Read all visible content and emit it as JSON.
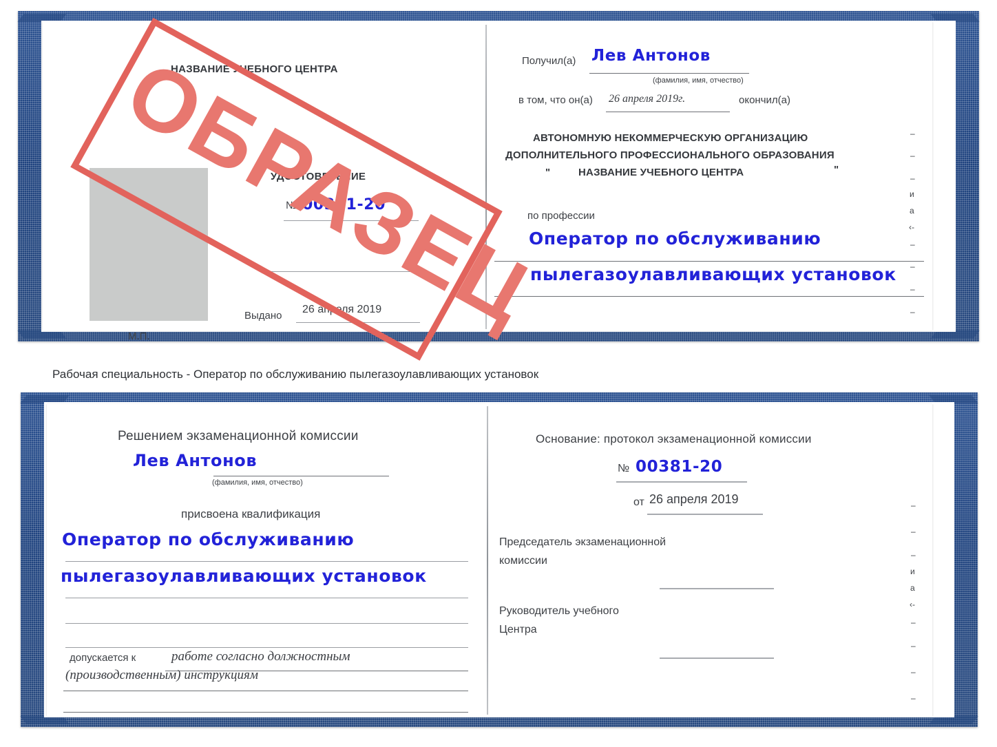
{
  "document": {
    "type": "udostoverenie-certificate-sample",
    "stamp_label": "ОБРАЗЕЦ",
    "caption": "Рабочая специальность - Оператор по обслуживанию пылегазоулавливающих установок"
  },
  "colors": {
    "cover_blue": "#24477f",
    "ink_blue": "#2222d8",
    "stamp_red": "#e2635c",
    "text_gray": "#3d4045",
    "photo_gray": "#c9cbca"
  },
  "cert_top": {
    "left_page": {
      "center_name": "НАЗВАНИЕ УЧЕБНОГО ЦЕНТРА",
      "title": "УДОСТОВЕРЕНИЕ",
      "number_prefix": "№",
      "number_value": "00381-20",
      "issued_label": "Выдано",
      "issued_value": "26 апреля 2019",
      "seal_label": "М.П.",
      "photo_placeholder": "photo-area"
    },
    "right_page": {
      "received_label": "Получил(а)",
      "received_value": "Лев Антонов",
      "fio_hint": "(фамилия, имя, отчество)",
      "in_that_label": "в том, что он(а)",
      "in_that_value": "26 апреля 2019г.",
      "finished_label": "окончил(а)",
      "org_line1": "АВТОНОМНУЮ НЕКОММЕРЧЕСКУЮ ОРГАНИЗАЦИЮ",
      "org_line2": "ДОПОЛНИТЕЛЬНОГО ПРОФЕССИОНАЛЬНОГО ОБРАЗОВАНИЯ",
      "org_quote_open": "\"",
      "org_line3": "НАЗВАНИЕ УЧЕБНОГО ЦЕНТРА",
      "org_quote_close": "\"",
      "profession_label": "по профессии",
      "profession_line1": "Оператор по обслуживанию",
      "profession_line2": "пылегазоулавливающих установок"
    }
  },
  "cert_bottom": {
    "left_page": {
      "heading": "Решением экзаменационной комиссии",
      "name_value": "Лев Антонов",
      "fio_hint": "(фамилия, имя, отчество)",
      "qualification_label": "присвоена квалификация",
      "qualification_line1": "Оператор по обслуживанию",
      "qualification_line2": "пылегазоулавливающих установок",
      "allowed_label": "допускается к",
      "allowed_value_line1": "работе согласно должностным",
      "allowed_value_line2": "(производственным) инструкциям"
    },
    "right_page": {
      "basis_label": "Основание: протокол экзаменационной комиссии",
      "number_prefix": "№",
      "number_value": "00381-20",
      "date_prefix": "от",
      "date_value": "26 апреля 2019",
      "chairman_line1": "Председатель экзаменационной",
      "chairman_line2": "комиссии",
      "head_line1": "Руководитель учебного",
      "head_line2": "Центра"
    }
  },
  "edge_marks": {
    "top": [
      "–",
      "–",
      "–",
      "и",
      "а",
      "‹-",
      "–",
      "–",
      "–",
      "–"
    ],
    "bottom": [
      "–",
      "–",
      "–",
      "и",
      "а",
      "‹-",
      "–",
      "–",
      "–",
      "–"
    ]
  }
}
